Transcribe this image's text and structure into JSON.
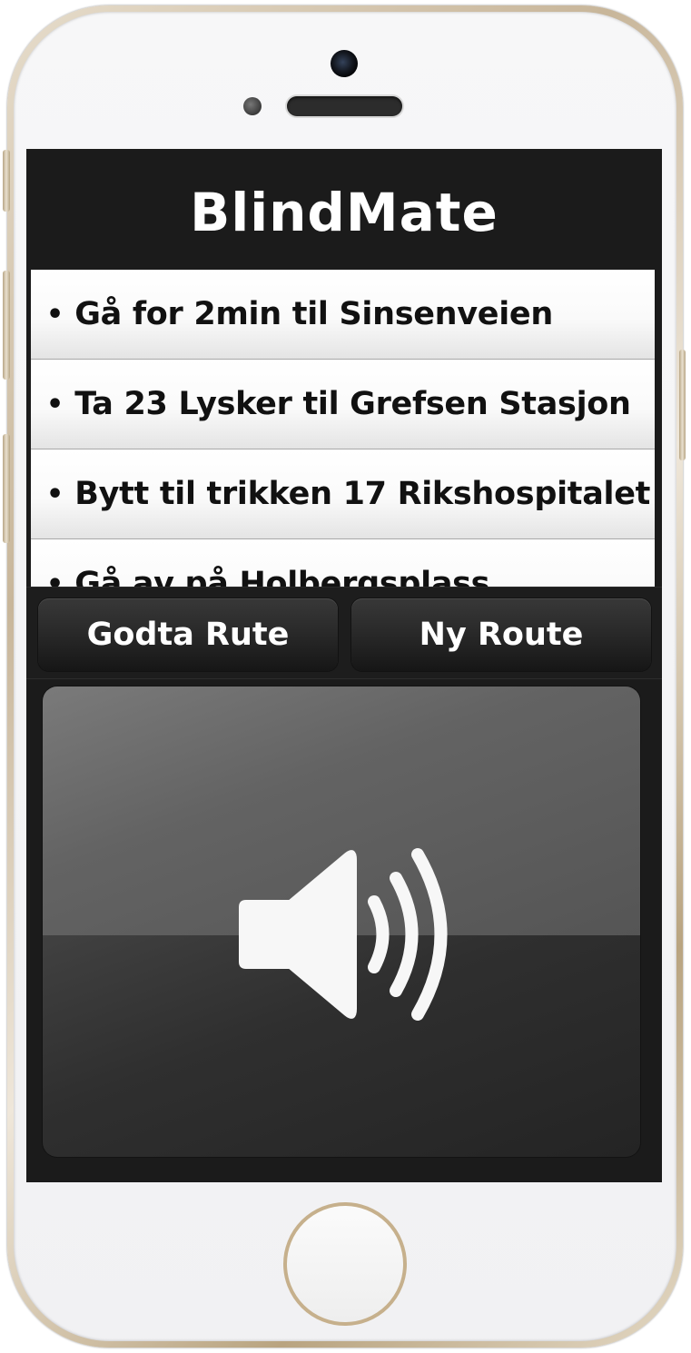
{
  "app": {
    "title": "BlindMate"
  },
  "route": {
    "steps": [
      {
        "bullet": "•",
        "text": "Gå for 2min til Sinsenveien"
      },
      {
        "bullet": "•",
        "text": "Ta 23 Lysker til Grefsen Stasjon"
      },
      {
        "bullet": "•",
        "text": "Bytt til trikken 17 Rikshospitalet"
      },
      {
        "bullet": "•",
        "text": "Gå av på Holbergsplass"
      }
    ]
  },
  "actions": {
    "accept_label": "Godta Rute",
    "new_label": "Ny Route"
  },
  "sound": {
    "icon": "speaker-volume-icon"
  },
  "colors": {
    "screen_background": "#1b1b1b",
    "title_text": "#ffffff",
    "list_background": "#ffffff",
    "frame_gold": "#c8b69a"
  }
}
